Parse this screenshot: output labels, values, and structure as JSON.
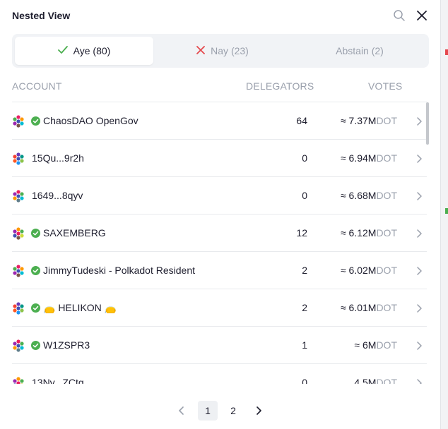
{
  "modal": {
    "title": "Nested View"
  },
  "tabs": [
    {
      "label": "Aye (80)",
      "active": true
    },
    {
      "label": "Nay (23)",
      "active": false
    },
    {
      "label": "Abstain (2)",
      "active": false
    }
  ],
  "columns": {
    "account": "ACCOUNT",
    "delegators": "DELEGATORS",
    "votes": "VOTES"
  },
  "rows": [
    {
      "name": "ChaosDAO OpenGov",
      "verified": true,
      "delegators": "64",
      "votes": "≈ 7.37M",
      "unit": "DOT"
    },
    {
      "name": "15Qu...9r2h",
      "verified": false,
      "delegators": "0",
      "votes": "≈ 6.94M",
      "unit": "DOT"
    },
    {
      "name": "1649...8qyv",
      "verified": false,
      "delegators": "0",
      "votes": "≈ 6.68M",
      "unit": "DOT"
    },
    {
      "name": "SAXEMBERG",
      "verified": true,
      "delegators": "12",
      "votes": "≈ 6.12M",
      "unit": "DOT"
    },
    {
      "name": "JimmyTudeski - Polkadot Resident",
      "verified": true,
      "delegators": "2",
      "votes": "≈ 6.02M",
      "unit": "DOT"
    },
    {
      "name": "👝 HELIKON 👝",
      "verified": true,
      "delegators": "2",
      "votes": "≈ 6.01M",
      "unit": "DOT"
    },
    {
      "name": "W1ZSPR3",
      "verified": true,
      "delegators": "1",
      "votes": "≈ 6M",
      "unit": "DOT"
    },
    {
      "name": "13Ny...ZCtq",
      "verified": false,
      "delegators": "0",
      "votes": "4.5M",
      "unit": "DOT"
    }
  ],
  "pagination": {
    "pages": [
      "1",
      "2"
    ],
    "current": "1"
  },
  "colors": {
    "accent_green": "#4caf50",
    "nay_red": "#e5484d",
    "muted": "#9aa0ac"
  }
}
